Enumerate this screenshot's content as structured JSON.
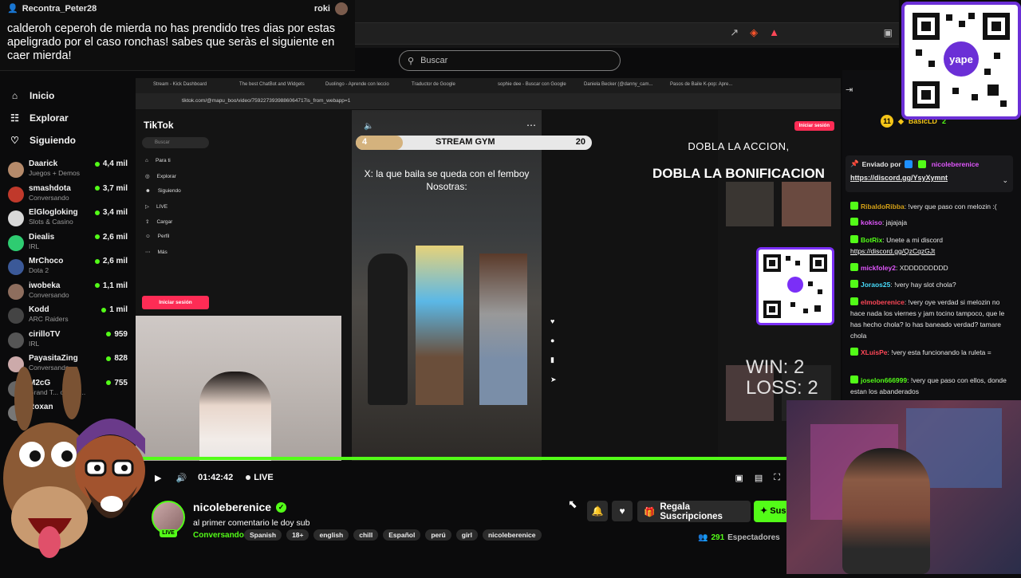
{
  "donation": {
    "from": "Recontra_Peter28",
    "to": "roki",
    "message": "calderoh ceperoh de mierda no has prendido tres dias por estas apeligrado por el caso ronchas! sabes que seràs el siguiente en caer mierda!"
  },
  "search": {
    "placeholder": "Buscar"
  },
  "nav": [
    {
      "label": "Inicio",
      "icon": "home-icon"
    },
    {
      "label": "Explorar",
      "icon": "compass-icon"
    },
    {
      "label": "Siguiendo",
      "icon": "heart-icon"
    }
  ],
  "channels": [
    {
      "name": "Daarick",
      "category": "Juegos + Demos",
      "viewers": "4,4 mil",
      "color": "#b58a6a"
    },
    {
      "name": "smashdota",
      "category": "Conversando",
      "viewers": "3,7 mil",
      "color": "#c0392b"
    },
    {
      "name": "ElGlogloking",
      "category": "Slots & Casino",
      "viewers": "3,4 mil",
      "color": "#d8d8d8"
    },
    {
      "name": "Diealis",
      "category": "IRL",
      "viewers": "2,6 mil",
      "color": "#2ecc71"
    },
    {
      "name": "MrChoco",
      "category": "Dota 2",
      "viewers": "2,6 mil",
      "color": "#3b5998"
    },
    {
      "name": "iwobeka",
      "category": "Conversando",
      "viewers": "1,1 mil",
      "color": "#8e6e5e"
    },
    {
      "name": "Kodd",
      "category": "ARC Raiders",
      "viewers": "1 mil",
      "color": "#444"
    },
    {
      "name": "cirilloTV",
      "category": "IRL",
      "viewers": "959",
      "color": "#555"
    },
    {
      "name": "PayasitaZing",
      "category": "Conversando",
      "viewers": "828",
      "color": "#caa"
    },
    {
      "name": "M2cG",
      "category": "Grand T... o V (G...",
      "viewers": "755",
      "color": "#666"
    },
    {
      "name": "Roxan",
      "category": "",
      "viewers": "",
      "color": "#777"
    }
  ],
  "browser_tabs": [
    "Stream - Kick Dashboard",
    "The best ChatBot and Widgets",
    "Duolingo - Aprende con leccio",
    "Traductor de Google",
    "sophie dee - Buscar con Google",
    "Daniela Becker (@danny_cam...",
    "Pasos de Baile K-pop: Apre..."
  ],
  "browser_url": "tiktok.com/@mapu_boo/video/7592273939886064717is_from_webapp=1",
  "tiktok": {
    "logo": "TikTok",
    "search": "Buscar",
    "menu": [
      "Para ti",
      "Explorar",
      "Siguiendo",
      "LIVE",
      "Cargar",
      "Perfil",
      "Más"
    ],
    "login": "Iniciar sesión",
    "login_top": "Iniciar sesión"
  },
  "overlay": {
    "gym_start": "4",
    "gym_title": "STREAM GYM",
    "gym_count": "20",
    "gym_progress": 0.2,
    "caption_line1": "X: la que baila se queda con el femboy",
    "caption_line2": "Nosotras:",
    "bonus1": "DOBLA LA ACCION,",
    "bonus2": "DOBLA LA BONIFICACION",
    "win": "WIN: 2",
    "loss": "LOSS: 2"
  },
  "player": {
    "time": "01:42:42",
    "live": "LIVE"
  },
  "stream": {
    "name": "nicoleberenice",
    "title": "al primer comentario le doy sub",
    "category": "Conversando",
    "tags": [
      "Spanish",
      "18+",
      "english",
      "chill",
      "Español",
      "perú",
      "girl",
      "nicoleberenice"
    ],
    "gift_label": "Regala Suscripciones",
    "sub_label": "Suscribirse",
    "viewers_count": "291",
    "viewers_label": "Espectadores",
    "live": "LIVE"
  },
  "chat_header": {
    "gifter_badge": "11",
    "user": "BasicLD",
    "count": "2"
  },
  "pinned": {
    "label": "Enviado por",
    "user": "nicoleberenice",
    "link": "https://discord.gg/YsyXymnt"
  },
  "chat": [
    {
      "user": "RibaldoRibba",
      "color": "#d4a017",
      "text": "!very que paso con melozin :("
    },
    {
      "user": "kokiso",
      "color": "#e056fd",
      "text": "jajajaja"
    },
    {
      "user": "BotRix",
      "color": "#53fc18",
      "text": "Unete a mi discord",
      "link": "https://discord.gg/QzCqzGJt"
    },
    {
      "user": "mickfoley2",
      "color": "#e056fd",
      "text": "XDDDDDDDDD"
    },
    {
      "user": "Joraos25",
      "color": "#48dbfb",
      "text": "!very hay slot chola?"
    },
    {
      "user": "elmoberenice",
      "color": "#ff4757",
      "text": "!very oye verdad si melozin no hace nada los viernes y jam tocino tampoco, que le has hecho chola? lo has baneado verdad? tamare chola"
    },
    {
      "user": "XLuisPe",
      "color": "#ff4757",
      "text": "!very esta funcionando la ruleta ="
    },
    {
      "user": "joselon666999",
      "color": "#53fc18",
      "text": "!very que paso con ellos, donde estan los abanderados"
    }
  ],
  "colors": {
    "accent": "#53fc18",
    "background": "#0b0b0c",
    "qr_border": "#6b2fd6"
  }
}
